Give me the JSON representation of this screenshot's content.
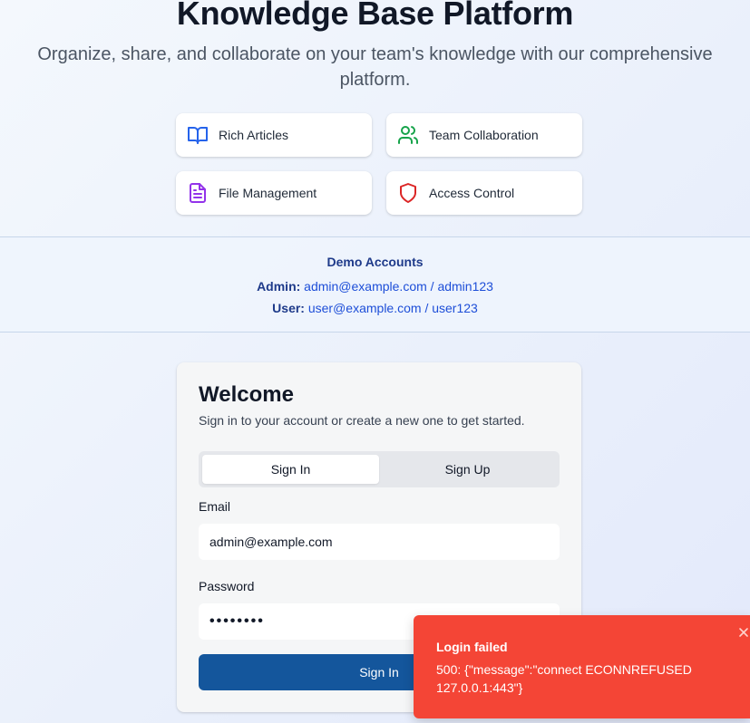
{
  "header": {
    "title": "Knowledge Base Platform",
    "subtitle": "Organize, share, and collaborate on your team's knowledge with our comprehensive platform."
  },
  "features": [
    {
      "label": "Rich Articles",
      "icon": "book-open-icon",
      "color": "#2563eb"
    },
    {
      "label": "Team Collaboration",
      "icon": "users-icon",
      "color": "#16a34a"
    },
    {
      "label": "File Management",
      "icon": "file-text-icon",
      "color": "#9333ea"
    },
    {
      "label": "Access Control",
      "icon": "shield-icon",
      "color": "#dc2626"
    }
  ],
  "demo": {
    "title": "Demo Accounts",
    "admin_label": "Admin:",
    "admin_value": "admin@example.com / admin123",
    "user_label": "User:",
    "user_value": "user@example.com / user123"
  },
  "auth": {
    "title": "Welcome",
    "subtitle": "Sign in to your account or create a new one to get started.",
    "tabs": [
      {
        "label": "Sign In",
        "active": true
      },
      {
        "label": "Sign Up",
        "active": false
      }
    ],
    "email_label": "Email",
    "email_value": "admin@example.com",
    "password_label": "Password",
    "password_value": "••••••••",
    "submit_label": "Sign In"
  },
  "toast": {
    "title": "Login failed",
    "message": "500: {\"message\":\"connect ECONNREFUSED 127.0.0.1:443\"}",
    "color": "#f44536"
  }
}
